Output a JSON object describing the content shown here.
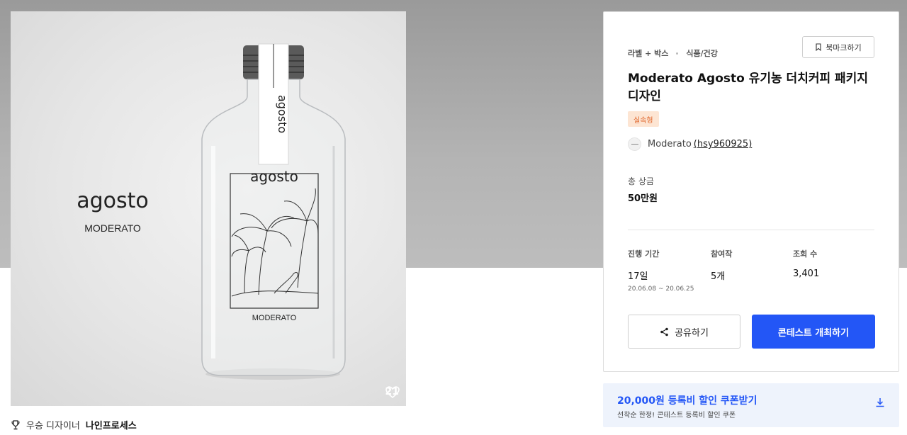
{
  "hero": {
    "brand_logo_text": "agosto",
    "brand_name": "MODERATO",
    "likes": "21"
  },
  "award": {
    "label": "우승 디자이너",
    "name": "나인프로세스"
  },
  "contest": {
    "categories": [
      "라벨 + 박스",
      "식품/건강"
    ],
    "bookmark_label": "북마크하기",
    "title": "Moderato Agosto 유기농 더치커피 패키지 디자인",
    "badge": "실속형",
    "author_name": "Moderato",
    "author_id": "(hsy960925)",
    "prize_label": "총 상금",
    "prize_value": "50만원",
    "stats": [
      {
        "label": "진행 기간",
        "value": "17일",
        "sub": "20.06.08 ~ 20.06.25"
      },
      {
        "label": "참여작",
        "value": "5개"
      },
      {
        "label": "조회 수",
        "value": "3,401"
      }
    ],
    "share_label": "공유하기",
    "host_label": "콘테스트 개최하기",
    "accent_color": "#2356f6"
  },
  "coupon": {
    "title": "20,000원 등록비 할인 쿠폰받기",
    "subtitle": "선착순 한정! 콘테스트 등록비 할인 쿠폰"
  }
}
